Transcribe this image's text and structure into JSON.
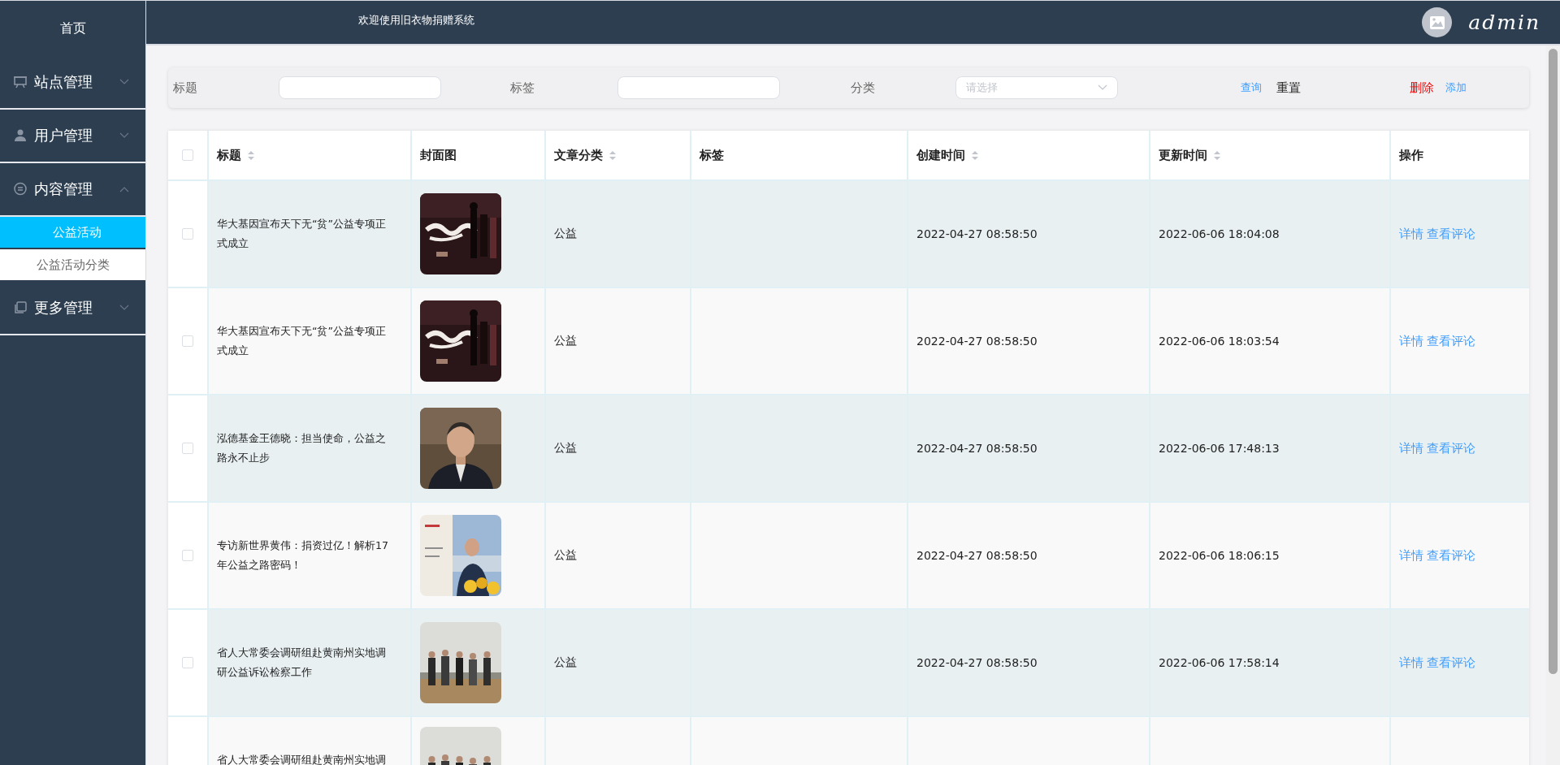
{
  "sidebar": {
    "home": "首页",
    "menus": [
      {
        "label": "站点管理",
        "expanded": false
      },
      {
        "label": "用户管理",
        "expanded": false
      },
      {
        "label": "内容管理",
        "expanded": true,
        "children": [
          {
            "label": "公益活动",
            "selected": true
          },
          {
            "label": "公益活动分类",
            "selected": false
          }
        ]
      },
      {
        "label": "更多管理",
        "expanded": false
      }
    ]
  },
  "header": {
    "title": "欢迎使用旧衣物捐赠系统",
    "user": "admin"
  },
  "filters": {
    "fields": [
      {
        "kind": "input",
        "label": "标题"
      },
      {
        "kind": "input",
        "label": "标签"
      },
      {
        "kind": "select",
        "label": "分类",
        "placeholder": "请选择"
      }
    ],
    "buttons": [
      {
        "label": "查询",
        "kind": "link"
      },
      {
        "label": "重置",
        "kind": "plain"
      },
      {
        "label": "删除",
        "kind": "danger"
      },
      {
        "label": "添加",
        "kind": "link"
      }
    ]
  },
  "table": {
    "select_all": {
      "checked": false
    },
    "columns": [
      {
        "label": "标题",
        "sortable": true
      },
      {
        "label": "封面图",
        "sortable": false
      },
      {
        "label": "文章分类",
        "sortable": true
      },
      {
        "label": "标签",
        "sortable": false
      },
      {
        "label": "创建时间",
        "sortable": true
      },
      {
        "label": "更新时间",
        "sortable": true
      },
      {
        "label": "操作",
        "sortable": false
      }
    ],
    "rows": [
      {
        "checked": false,
        "title": "华大基因宣布天下无“贫”公益专项正式成立",
        "cover": {
          "kind": "picture"
        },
        "category": "公益",
        "created": "2022-04-27 08:58:50",
        "updated": "2022-06-06 18:04:08",
        "actions": [
          "详情",
          "查看评论"
        ]
      },
      {
        "checked": false,
        "title": "华大基因宣布天下无“贫”公益专项正式成立",
        "cover": {
          "kind": "picture"
        },
        "category": "公益",
        "created": "2022-04-27 08:58:50",
        "updated": "2022-06-06 18:03:54",
        "actions": [
          "详情",
          "查看评论"
        ]
      },
      {
        "checked": false,
        "title": "泓德基金王德晓：担当使命，公益之路永不止步",
        "cover": {
          "kind": "picture"
        },
        "category": "公益",
        "created": "2022-04-27 08:58:50",
        "updated": "2022-06-06 17:48:13",
        "actions": [
          "详情",
          "查看评论"
        ]
      },
      {
        "checked": false,
        "title": "专访新世界黄伟：捐资过亿！解析17年公益之路密码！",
        "cover": {
          "kind": "picture"
        },
        "category": "公益",
        "created": "2022-04-27 08:58:50",
        "updated": "2022-06-06 18:06:15",
        "actions": [
          "详情",
          "查看评论"
        ]
      },
      {
        "checked": false,
        "title": "省人大常委会调研组赴黄南州实地调研公益诉讼检察工作",
        "cover": {
          "kind": "picture"
        },
        "category": "公益",
        "created": "2022-04-27 08:58:50",
        "updated": "2022-06-06 17:58:14",
        "actions": [
          "详情",
          "查看评论"
        ]
      },
      {
        "title": "省人大常委会调研组赴黄南州实地调",
        "cover": {
          "kind": "picture"
        }
      }
    ]
  }
}
